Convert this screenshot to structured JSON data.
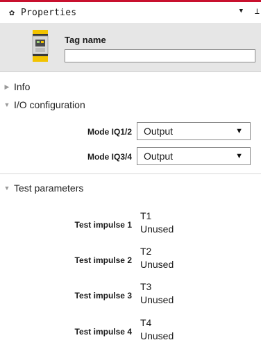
{
  "panel": {
    "title": "Properties",
    "menu_glyph": "▼",
    "pin_glyph": "▕"
  },
  "header": {
    "tag_label": "Tag name",
    "tag_value": ""
  },
  "sections": {
    "info": "Info",
    "io": "I/O configuration",
    "test": "Test parameters"
  },
  "io_config": [
    {
      "label": "Mode IQ1/2",
      "value": "Output"
    },
    {
      "label": "Mode IQ3/4",
      "value": "Output"
    }
  ],
  "test_impulses": [
    {
      "label": "Test impulse 1",
      "name": "T1",
      "status": "Unused"
    },
    {
      "label": "Test impulse 2",
      "name": "T2",
      "status": "Unused"
    },
    {
      "label": "Test impulse 3",
      "name": "T3",
      "status": "Unused"
    },
    {
      "label": "Test impulse 4",
      "name": "T4",
      "status": "Unused"
    }
  ],
  "colors": {
    "accent": "#c8102e",
    "header_bg": "#e6e6e6",
    "device_yellow": "#f2c300"
  },
  "icons": [
    "gear-icon",
    "dropdown-menu-icon",
    "pin-icon",
    "device-icon",
    "chevron-right-icon",
    "chevron-down-icon",
    "dropdown-arrow-icon"
  ]
}
